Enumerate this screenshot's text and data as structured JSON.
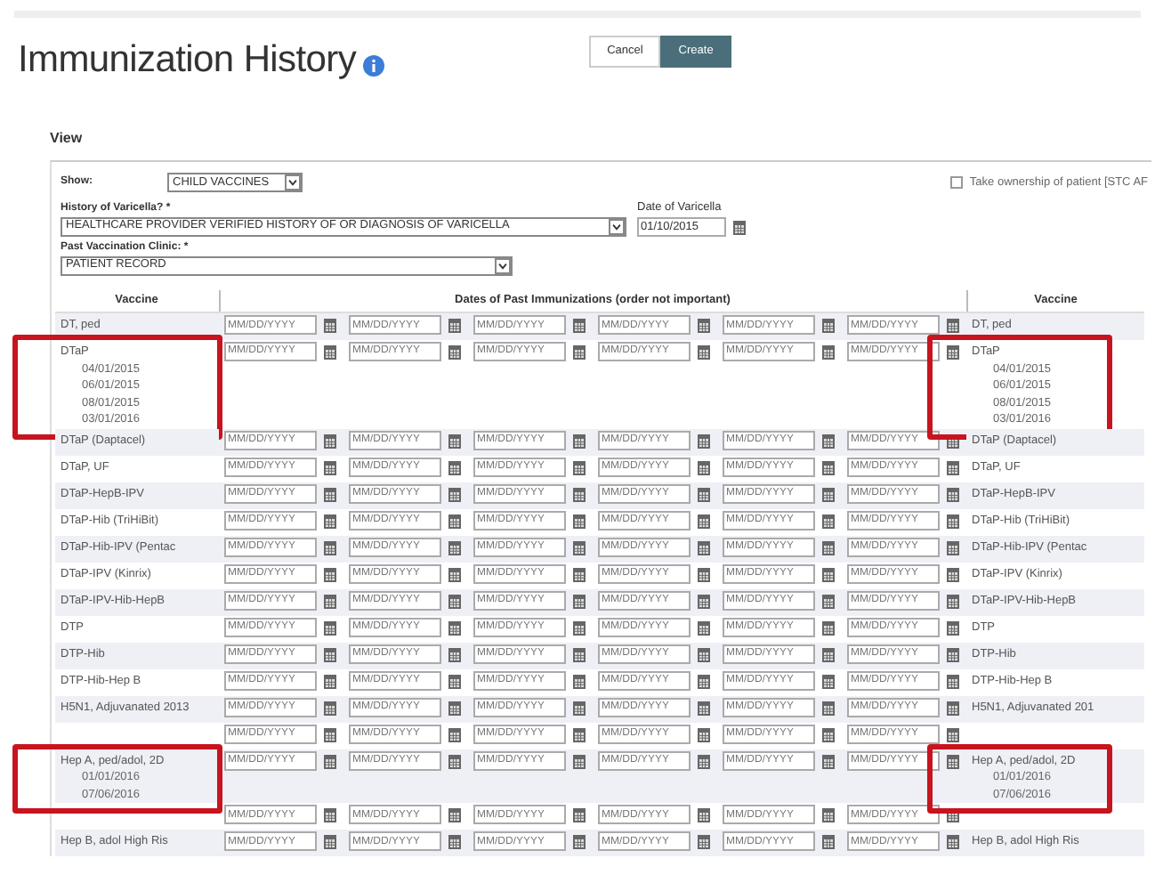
{
  "page": {
    "title": "Immunization History"
  },
  "buttons": [
    {
      "label": "Cancel",
      "kind": "secondary"
    },
    {
      "label": "Create",
      "kind": "primary"
    }
  ],
  "section": {
    "title": "View"
  },
  "filters": {
    "show": {
      "label": "Show:",
      "value": "CHILD VACCINES"
    },
    "ownership": {
      "label": "Take ownership of patient [STC AF",
      "checked": false
    },
    "varicella_history": {
      "label": "History of Varicella? *",
      "value": "HEALTHCARE PROVIDER VERIFIED HISTORY OF OR DIAGNOSIS OF VARICELLA"
    },
    "varicella_date": {
      "label": "Date of Varicella",
      "value": "01/10/2015"
    },
    "clinic": {
      "label": "Past Vaccination Clinic: *",
      "value": "PATIENT RECORD"
    }
  },
  "table": {
    "columns": [
      "Vaccine",
      "Dates of Past Immunizations (order not important)",
      "Vaccine"
    ],
    "rows": [
      {
        "vaccine": "DT, ped",
        "history": [],
        "placeholders": [
          "MM/DD/YYYY",
          "MM/DD/YYYY",
          "MM/DD/YYYY",
          "MM/DD/YYYY",
          "MM/DD/YYYY",
          "MM/DD/YYYY"
        ],
        "vaccine_right": "DT, ped",
        "highlighted": false
      },
      {
        "vaccine": "DTaP",
        "history": [
          "04/01/2015",
          "06/01/2015",
          "08/01/2015",
          "03/01/2016"
        ],
        "placeholders": [
          "MM/DD/YYYY",
          "MM/DD/YYYY",
          "MM/DD/YYYY",
          "MM/DD/YYYY",
          "MM/DD/YYYY",
          "MM/DD/YYYY"
        ],
        "vaccine_right": "DTaP",
        "history_right": [
          "04/01/2015",
          "06/01/2015",
          "08/01/2015",
          "03/01/2016"
        ],
        "highlighted": true
      },
      {
        "vaccine": "DTaP (Daptacel)",
        "history": [],
        "placeholders": [
          "MM/DD/YYYY",
          "MM/DD/YYYY",
          "MM/DD/YYYY",
          "MM/DD/YYYY",
          "MM/DD/YYYY",
          "MM/DD/YYYY"
        ],
        "vaccine_right": "DTaP (Daptacel)",
        "highlighted": false
      },
      {
        "vaccine": "DTaP, UF",
        "history": [],
        "placeholders": [
          "MM/DD/YYYY",
          "MM/DD/YYYY",
          "MM/DD/YYYY",
          "MM/DD/YYYY",
          "MM/DD/YYYY",
          "MM/DD/YYYY"
        ],
        "vaccine_right": "DTaP, UF",
        "highlighted": false
      },
      {
        "vaccine": "DTaP-HepB-IPV",
        "history": [],
        "placeholders": [
          "MM/DD/YYYY",
          "MM/DD/YYYY",
          "MM/DD/YYYY",
          "MM/DD/YYYY",
          "MM/DD/YYYY",
          "MM/DD/YYYY"
        ],
        "vaccine_right": "DTaP-HepB-IPV",
        "highlighted": false
      },
      {
        "vaccine": "DTaP-Hib (TriHiBit)",
        "history": [],
        "placeholders": [
          "MM/DD/YYYY",
          "MM/DD/YYYY",
          "MM/DD/YYYY",
          "MM/DD/YYYY",
          "MM/DD/YYYY",
          "MM/DD/YYYY"
        ],
        "vaccine_right": "DTaP-Hib (TriHiBit)",
        "highlighted": false
      },
      {
        "vaccine": "DTaP-Hib-IPV (Pentac",
        "history": [],
        "placeholders": [
          "MM/DD/YYYY",
          "MM/DD/YYYY",
          "MM/DD/YYYY",
          "MM/DD/YYYY",
          "MM/DD/YYYY",
          "MM/DD/YYYY"
        ],
        "vaccine_right": "DTaP-Hib-IPV (Pentac",
        "highlighted": false
      },
      {
        "vaccine": "DTaP-IPV (Kinrix)",
        "history": [],
        "placeholders": [
          "MM/DD/YYYY",
          "MM/DD/YYYY",
          "MM/DD/YYYY",
          "MM/DD/YYYY",
          "MM/DD/YYYY",
          "MM/DD/YYYY"
        ],
        "vaccine_right": "DTaP-IPV (Kinrix)",
        "highlighted": false
      },
      {
        "vaccine": "DTaP-IPV-Hib-HepB",
        "history": [],
        "placeholders": [
          "MM/DD/YYYY",
          "MM/DD/YYYY",
          "MM/DD/YYYY",
          "MM/DD/YYYY",
          "MM/DD/YYYY",
          "MM/DD/YYYY"
        ],
        "vaccine_right": "DTaP-IPV-Hib-HepB",
        "highlighted": false
      },
      {
        "vaccine": "DTP",
        "history": [],
        "placeholders": [
          "MM/DD/YYYY",
          "MM/DD/YYYY",
          "MM/DD/YYYY",
          "MM/DD/YYYY",
          "MM/DD/YYYY",
          "MM/DD/YYYY"
        ],
        "vaccine_right": "DTP",
        "highlighted": false
      },
      {
        "vaccine": "DTP-Hib",
        "history": [],
        "placeholders": [
          "MM/DD/YYYY",
          "MM/DD/YYYY",
          "MM/DD/YYYY",
          "MM/DD/YYYY",
          "MM/DD/YYYY",
          "MM/DD/YYYY"
        ],
        "vaccine_right": "DTP-Hib",
        "highlighted": false
      },
      {
        "vaccine": "DTP-Hib-Hep B",
        "history": [],
        "placeholders": [
          "MM/DD/YYYY",
          "MM/DD/YYYY",
          "MM/DD/YYYY",
          "MM/DD/YYYY",
          "MM/DD/YYYY",
          "MM/DD/YYYY"
        ],
        "vaccine_right": "DTP-Hib-Hep B",
        "highlighted": false
      },
      {
        "vaccine": "H5N1, Adjuvanated 2013",
        "history": [],
        "placeholders": [
          "MM/DD/YYYY",
          "MM/DD/YYYY",
          "MM/DD/YYYY",
          "MM/DD/YYYY",
          "MM/DD/YYYY",
          "MM/DD/YYYY"
        ],
        "vaccine_right": "H5N1, Adjuvanated 201",
        "highlighted": false
      },
      {
        "history": [],
        "placeholders": [
          "MM/DD/YYYY",
          "MM/DD/YYYY",
          "MM/DD/YYYY",
          "MM/DD/YYYY",
          "MM/DD/YYYY",
          "MM/DD/YYYY"
        ],
        "highlighted": false
      },
      {
        "vaccine": "Hep A, ped/adol, 2D",
        "history": [
          "01/01/2016",
          "07/06/2016"
        ],
        "placeholders": [
          "MM/DD/YYYY",
          "MM/DD/YYYY",
          "MM/DD/YYYY",
          "MM/DD/YYYY",
          "MM/DD/YYYY",
          "MM/DD/YYYY"
        ],
        "vaccine_right": "Hep A, ped/adol, 2D",
        "history_right": [
          "01/01/2016",
          "07/06/2016"
        ],
        "highlighted": true
      },
      {
        "history": [],
        "placeholders": [
          "MM/DD/YYYY",
          "MM/DD/YYYY",
          "MM/DD/YYYY",
          "MM/DD/YYYY",
          "MM/DD/YYYY",
          "MM/DD/YYYY"
        ],
        "highlighted": false
      },
      {
        "vaccine": "Hep B, adol High Ris",
        "history": [],
        "placeholders": [
          "MM/DD/YYYY",
          "MM/DD/YYYY",
          "MM/DD/YYYY",
          "MM/DD/YYYY",
          "MM/DD/YYYY",
          "MM/DD/YYYY"
        ],
        "vaccine_right": "Hep B, adol High Ris",
        "highlighted": false
      }
    ]
  }
}
